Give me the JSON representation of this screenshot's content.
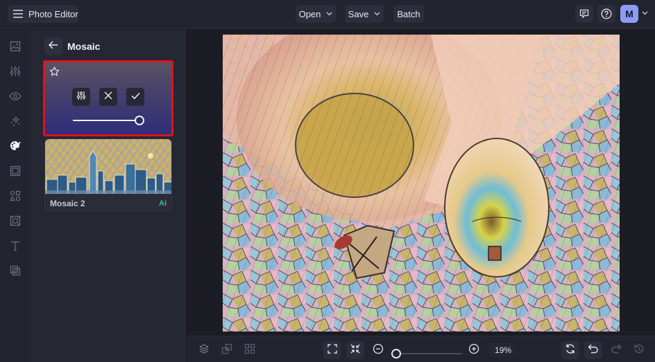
{
  "topbar": {
    "app_title": "Photo Editor",
    "menu_icon": "hamburger-menu-icon",
    "open_label": "Open",
    "save_label": "Save",
    "batch_label": "Batch",
    "feedback_icon": "comment-icon",
    "help_icon": "help-circle-icon",
    "avatar_initial": "M",
    "avatar_color": "#8e9bf5"
  },
  "rail": {
    "items": [
      {
        "name": "image",
        "icon": "image-icon",
        "active": false
      },
      {
        "name": "adjust",
        "icon": "sliders-icon",
        "active": false
      },
      {
        "name": "touch-up",
        "icon": "eye-icon",
        "active": false
      },
      {
        "name": "effects",
        "icon": "sparkles-icon",
        "active": false
      },
      {
        "name": "artsy",
        "icon": "palette-icon",
        "active": true
      },
      {
        "name": "frames",
        "icon": "frame-icon",
        "active": false
      },
      {
        "name": "graphics",
        "icon": "shapes-icon",
        "active": false
      },
      {
        "name": "textures",
        "icon": "texture-icon",
        "active": false
      },
      {
        "name": "text",
        "icon": "text-icon",
        "active": false
      },
      {
        "name": "overlays",
        "icon": "overlay-icon",
        "active": false
      }
    ]
  },
  "panel": {
    "title": "Mosaic",
    "active_effect": {
      "highlight_color": "#e0121b",
      "intensity_percent": 100
    },
    "presets": [
      {
        "label": "Mosaic 2",
        "badge": "Ai",
        "badge_color": "#33c58f"
      }
    ]
  },
  "canvas": {
    "description": "Hot air balloons with mosaic / stained-glass effect applied"
  },
  "bottombar": {
    "zoom_value": "19%",
    "zoom_fraction": 0.0
  }
}
